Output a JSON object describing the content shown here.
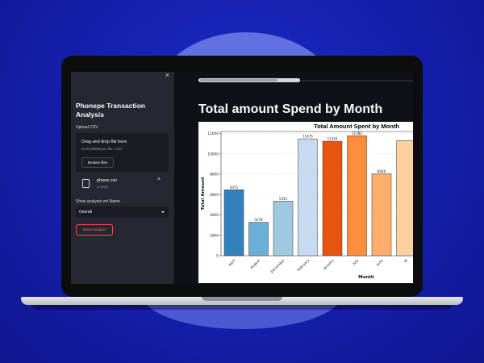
{
  "sidebar": {
    "close_label": "×",
    "app_title": "Phonepe Transaction Analysis",
    "upload_label": "Upload CSV",
    "uploader": {
      "title": "Drag and drop file here",
      "subtitle": "Limit 200MB per file • CSV",
      "browse_label": "Browse files"
    },
    "file": {
      "name": "phoen.csv",
      "size": "(4.9KB)",
      "remove_label": "×"
    },
    "select_label": "Show analysis wrt Name",
    "select_value": "Overall",
    "show_button": "Show Analysis"
  },
  "main": {
    "page_title": "Total amount Spend by Month"
  },
  "chart_data": {
    "type": "bar",
    "title": "Total Amount Spent by Month",
    "xlabel": "Month",
    "ylabel": "Total Amount",
    "categories": [
      "April",
      "August",
      "December",
      "February",
      "January",
      "July",
      "June",
      "M"
    ],
    "values": [
      6475,
      3278,
      5355,
      11475,
      11244,
      11782,
      8048,
      11300
    ],
    "data_labels": [
      "6475",
      "3278",
      "5355",
      "11475",
      "11244",
      "11782",
      "8048",
      ""
    ],
    "colors": [
      "#3182bd",
      "#6baed6",
      "#9ecae1",
      "#c6dbef",
      "#e6550d",
      "#fd8d3c",
      "#fdae6b",
      "#fdd0a2"
    ],
    "yticks": [
      "0",
      "2000",
      "4000",
      "6000",
      "8000",
      "10000",
      "12000"
    ],
    "ylim": [
      0,
      12200
    ],
    "grid": true
  }
}
